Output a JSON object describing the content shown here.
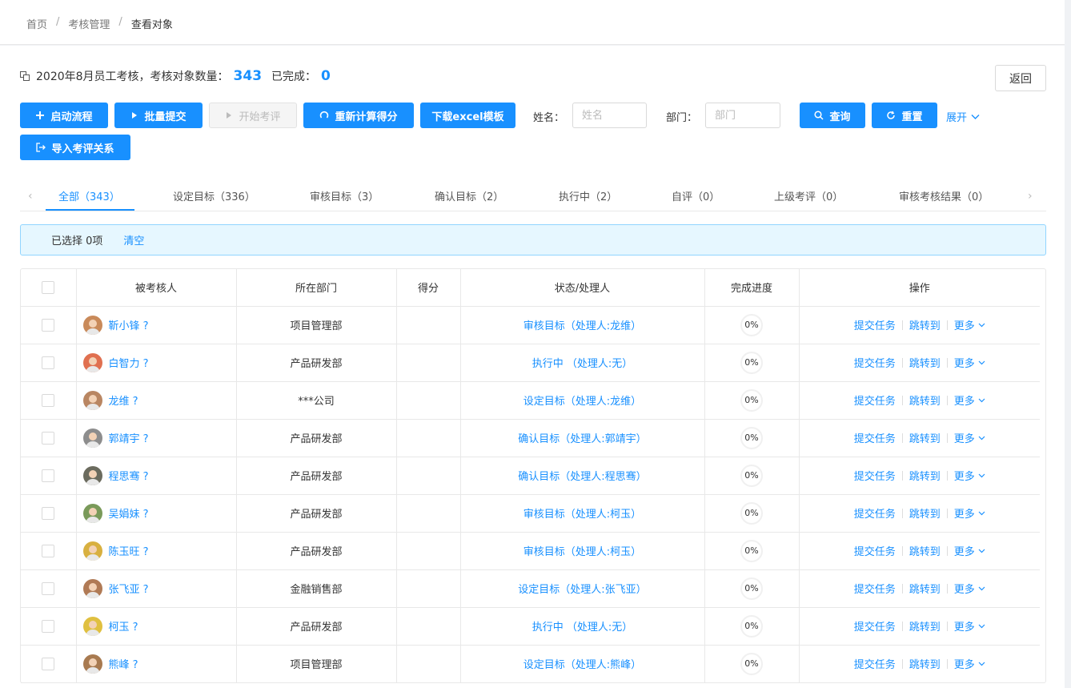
{
  "breadcrumb": [
    "首页",
    "考核管理",
    "查看对象"
  ],
  "summary": {
    "label": "2020年8月员工考核，考核对象数量：",
    "count": "343",
    "done_label": "已完成：",
    "done": "0"
  },
  "back_label": "返回",
  "toolbar": {
    "start_flow": "启动流程",
    "batch_submit": "批量提交",
    "start_review": "开始考评",
    "recalc": "重新计算得分",
    "download": "下载excel模板",
    "name_label": "姓名：",
    "name_placeholder": "姓名",
    "dept_label": "部门：",
    "dept_placeholder": "部门",
    "query": "查询",
    "reset": "重置",
    "expand": "展开",
    "import": "导入考评关系"
  },
  "tabs": [
    {
      "label": "全部（343）",
      "active": true
    },
    {
      "label": "设定目标（336）"
    },
    {
      "label": "审核目标（3）"
    },
    {
      "label": "确认目标（2）"
    },
    {
      "label": "执行中（2）"
    },
    {
      "label": "自评（0）"
    },
    {
      "label": "上级考评（0）"
    },
    {
      "label": "审核考核结果（0）"
    }
  ],
  "selection": {
    "text": "已选择 0项",
    "clear": "清空"
  },
  "table": {
    "columns": [
      "被考核人",
      "所在部门",
      "得分",
      "状态/处理人",
      "完成进度",
      "操作"
    ],
    "rows": [
      {
        "name": "靳小锋 ?",
        "dept": "项目管理部",
        "score": "",
        "status": "审核目标（处理人:龙维）",
        "progress": "0%",
        "avatar": "#c98a5a"
      },
      {
        "name": "白智力 ?",
        "dept": "产品研发部",
        "score": "",
        "status": "执行中  （处理人:无）",
        "progress": "0%",
        "avatar": "#e07050"
      },
      {
        "name": "龙维 ?",
        "dept": "***公司",
        "score": "",
        "status": "设定目标（处理人:龙维）",
        "progress": "0%",
        "avatar": "#b98662"
      },
      {
        "name": "郭靖宇 ?",
        "dept": "产品研发部",
        "score": "",
        "status": "确认目标（处理人:郭靖宇）",
        "progress": "0%",
        "avatar": "#8d8d8d"
      },
      {
        "name": "程思骞 ?",
        "dept": "产品研发部",
        "score": "",
        "status": "确认目标（处理人:程思骞）",
        "progress": "0%",
        "avatar": "#6b6b5e"
      },
      {
        "name": "吴娟妹 ?",
        "dept": "产品研发部",
        "score": "",
        "status": "审核目标（处理人:柯玉）",
        "progress": "0%",
        "avatar": "#7a9a5a"
      },
      {
        "name": "陈玉旺 ?",
        "dept": "产品研发部",
        "score": "",
        "status": "审核目标（处理人:柯玉）",
        "progress": "0%",
        "avatar": "#d8b040"
      },
      {
        "name": "张飞亚 ?",
        "dept": "金融销售部",
        "score": "",
        "status": "设定目标（处理人:张飞亚）",
        "progress": "0%",
        "avatar": "#b07a55"
      },
      {
        "name": "柯玉 ?",
        "dept": "产品研发部",
        "score": "",
        "status": "执行中  （处理人:无）",
        "progress": "0%",
        "avatar": "#e0c040"
      },
      {
        "name": "熊峰 ?",
        "dept": "项目管理部",
        "score": "",
        "status": "设定目标（处理人:熊峰）",
        "progress": "0%",
        "avatar": "#a87a50"
      }
    ],
    "actions": {
      "submit": "提交任务",
      "jump": "跳转到",
      "more": "更多"
    }
  },
  "colors": {
    "primary": "#1890ff",
    "alert_bg": "#e6f7ff",
    "alert_border": "#91d5ff"
  }
}
